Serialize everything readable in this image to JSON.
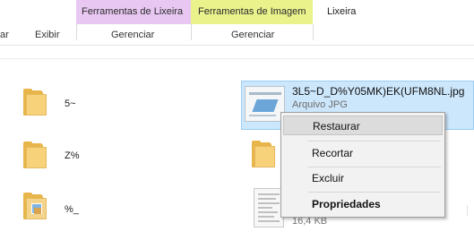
{
  "ribbon": {
    "tab_partial": "ar",
    "tab_view": "Exibir",
    "ctx_recycle": "Ferramentas de Lixeira",
    "ctx_image": "Ferramentas de Imagem",
    "tab_recycle_bin": "Lixeira",
    "group_manage_1": "Gerenciar",
    "group_manage_2": "Gerenciar",
    "colors": {
      "recycle": "#e8c8f2",
      "image": "#eaf28c"
    }
  },
  "files": [
    {
      "name": "5~",
      "icon": "folder-icon"
    },
    {
      "name": "Z%",
      "icon": "folder-icon"
    },
    {
      "name": "%_",
      "icon": "folder-with-image-icon"
    }
  ],
  "selected_file": {
    "name": "3L5~D_D%Y05MK)EK(UFM8NL.jpg",
    "type": "Arquivo JPG",
    "icon": "image-thumbnail-icon"
  },
  "other_file": {
    "size": "16,4 KB",
    "icon": "document-thumbnail-icon"
  },
  "context_menu": {
    "items": [
      "Restaurar",
      "Recortar",
      "Excluir",
      "Propriedades"
    ],
    "highlighted": "Restaurar",
    "bold": "Propriedades"
  }
}
